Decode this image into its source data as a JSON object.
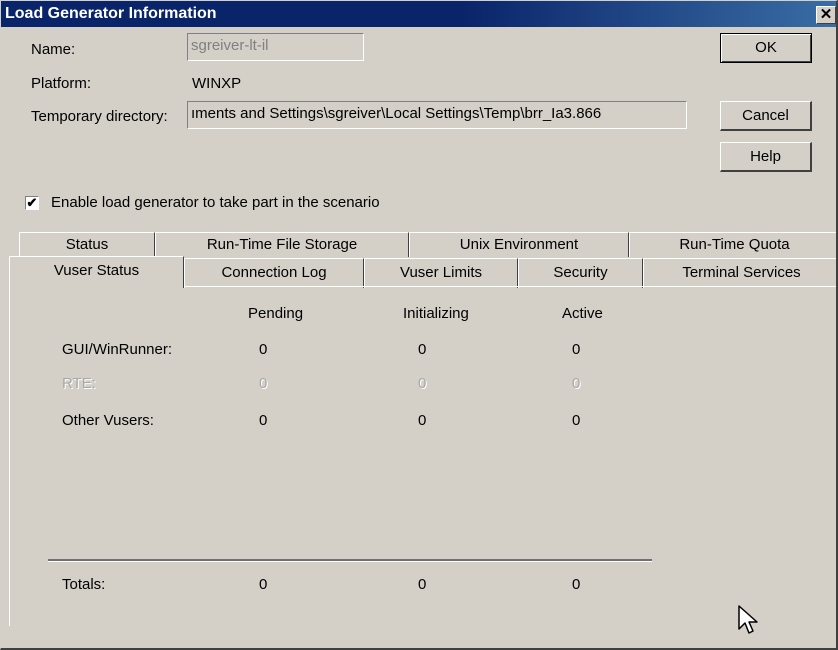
{
  "window": {
    "title": "Load Generator Information",
    "close_glyph": "✕"
  },
  "form": {
    "name_label": "Name:",
    "name_value": "sgreiver-lt-il",
    "platform_label": "Platform:",
    "platform_value": "WINXP",
    "temp_dir_label": "Temporary directory:",
    "temp_dir_value": "ıments and Settings\\sgreiver\\Local Settings\\Temp\\brr_Ia3.866",
    "enable_checked": true,
    "enable_label": "Enable load generator to take part in the scenario"
  },
  "buttons": {
    "ok": "OK",
    "cancel": "Cancel",
    "help": "Help"
  },
  "tabs": {
    "back_row": [
      "Status",
      "Run-Time File Storage",
      "Unix Environment",
      "Run-Time Quota"
    ],
    "front_row": [
      "Vuser Status",
      "Connection Log",
      "Vuser Limits",
      "Security",
      "Terminal Services"
    ],
    "selected": "Vuser Status"
  },
  "vuser_status": {
    "columns": [
      "Pending",
      "Initializing",
      "Active"
    ],
    "rows": [
      {
        "label": "GUI/WinRunner:",
        "values": [
          "0",
          "0",
          "0"
        ],
        "enabled": true
      },
      {
        "label": "RTE:",
        "values": [
          "0",
          "0",
          "0"
        ],
        "enabled": false
      },
      {
        "label": "Other Vusers:",
        "values": [
          "0",
          "0",
          "0"
        ],
        "enabled": true
      }
    ],
    "totals": {
      "label": "Totals:",
      "values": [
        "0",
        "0",
        "0"
      ]
    }
  },
  "icons": {
    "checkmark": "checkmark-icon",
    "cursor": "mouse-pointer-icon"
  }
}
